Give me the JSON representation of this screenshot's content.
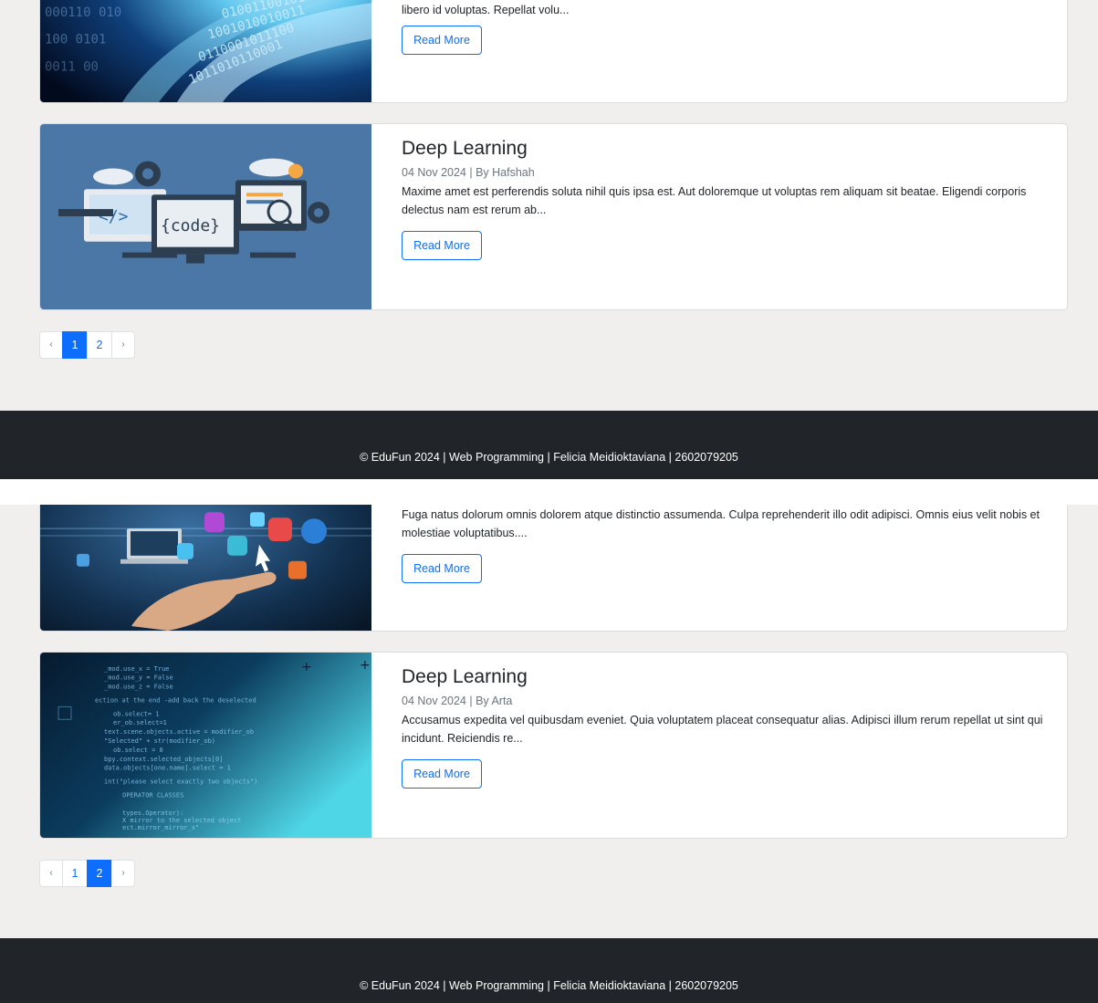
{
  "screens": [
    {
      "cards": [
        {
          "title": "",
          "meta": "",
          "excerpt": "libero id voluptas. Repellat volu...",
          "read_more": "Read More",
          "image_icon": "binary-tunnel-image"
        },
        {
          "title": "Deep Learning",
          "meta": "04 Nov 2024 | By Hafshah",
          "excerpt": "Maxime amet est perferendis soluta nihil quis ipsa est. Aut doloremque ut voluptas rem aliquam sit beatae. Eligendi corporis delectus nam est rerum ab...",
          "read_more": "Read More",
          "image_icon": "code-monitors-image"
        }
      ],
      "pagination": {
        "prev": "‹",
        "pages": [
          "1",
          "2"
        ],
        "active": "1",
        "next": "›"
      },
      "footer": "© EduFun 2024 | Web Programming | Felicia Meidioktaviana | 2602079205"
    },
    {
      "cards": [
        {
          "title": "",
          "meta": "",
          "excerpt": "Fuga natus dolorum omnis dolorem atque distinctio assumenda. Culpa reprehenderit illo odit adipisci. Omnis eius velit nobis et molestiae voluptatibus....",
          "read_more": "Read More",
          "image_icon": "floating-apps-hand-image"
        },
        {
          "title": "Deep Learning",
          "meta": "04 Nov 2024 | By Arta",
          "excerpt": "Accusamus expedita vel quibusdam eveniet. Quia voluptatem placeat consequatur alias. Adipisci illum rerum repellat ut sint qui incidunt. Reiciendis re...",
          "read_more": "Read More",
          "image_icon": "code-screen-image"
        }
      ],
      "pagination": {
        "prev": "‹",
        "pages": [
          "1",
          "2"
        ],
        "active": "2",
        "next": "›"
      },
      "footer": "© EduFun 2024 | Web Programming | Felicia Meidioktaviana | 2602079205"
    }
  ],
  "colors": {
    "page_background": "#f0efed",
    "primary": "#0d6efd",
    "footer_background": "#212529",
    "muted_text": "#6c757d"
  }
}
